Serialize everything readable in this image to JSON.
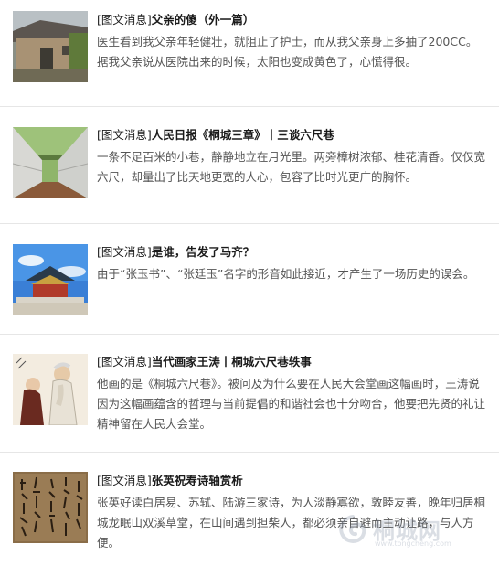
{
  "articles": [
    {
      "tag": "[图文消息]",
      "title": "父亲的傻（外一篇）",
      "desc": "医生看到我父亲年轻健壮，就阻止了护士，而从我父亲身上多抽了200CC。据我父亲说从医院出来的时候，太阳也变成黄色了，心慌得很。",
      "thumb_icon": "old-house-photo"
    },
    {
      "tag": "[图文消息]",
      "title": "人民日报《桐城三章》丨三谈六尺巷",
      "desc": "一条不足百米的小巷，静静地立在月光里。两旁樟树浓郁、桂花清香。仅仅宽六尺，却量出了比天地更宽的人心，包容了比时光更广的胸怀。",
      "thumb_icon": "alley-photo"
    },
    {
      "tag": "[图文消息]",
      "title": "是谁，告发了马齐？",
      "desc": "由于“张玉书”、“张廷玉”名字的形音如此接近，才产生了一场历史的误会。",
      "thumb_icon": "palace-photo"
    },
    {
      "tag": "[图文消息]",
      "title": "当代画家王涛丨桐城六尺巷轶事",
      "desc": "他画的是《桐城六尺巷》。被问及为什么要在人民大会堂画这幅画时，王涛说因为这幅画蕴含的哲理与当前提倡的和谐社会也十分吻合，他要把先贤的礼让精神留在人民大会堂。",
      "thumb_icon": "ink-painting"
    },
    {
      "tag": "[图文消息]",
      "title": "张英祝寿诗轴赏析",
      "desc": "张英好读白居易、苏轼、陆游三家诗，为人淡静寡欲，敦睦友善，晚年归居桐城龙眠山双溪草堂，在山间遇到担柴人，都必须亲自避而主动让路，与人方便。",
      "thumb_icon": "calligraphy-scroll"
    }
  ],
  "watermark": {
    "text": "桐城网",
    "url": "www.tongcheng.com",
    "logo_icon": "swirl-logo-icon"
  }
}
